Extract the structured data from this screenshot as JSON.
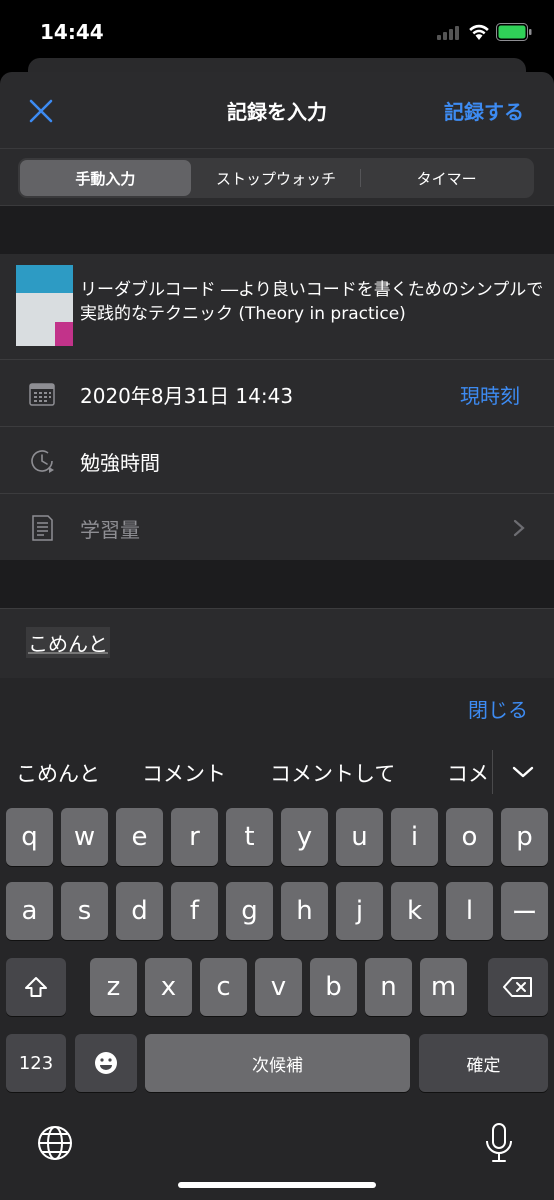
{
  "status": {
    "time": "14:44"
  },
  "nav": {
    "title": "記録を入力",
    "save_label": "記録する"
  },
  "tabs": [
    "手動入力",
    "ストップウォッチ",
    "タイマー"
  ],
  "book": {
    "title": "リーダブルコード ―より良いコードを書くためのシンプルで実践的なテクニック (Theory in practice)"
  },
  "fields": {
    "date": "2020年8月31日 14:43",
    "now_label": "現時刻",
    "study_time": "勉強時間",
    "amount_placeholder": "学習量"
  },
  "comment": {
    "value": "こめんと"
  },
  "keyboard": {
    "close_label": "閉じる",
    "suggestions": [
      "こめんと",
      "コメント",
      "コメントして",
      "コメ"
    ],
    "row1": [
      "q",
      "w",
      "e",
      "r",
      "t",
      "y",
      "u",
      "i",
      "o",
      "p"
    ],
    "row2": [
      "a",
      "s",
      "d",
      "f",
      "g",
      "h",
      "j",
      "k",
      "l",
      "ー"
    ],
    "row3": [
      "z",
      "x",
      "c",
      "v",
      "b",
      "n",
      "m"
    ],
    "num_label": "123",
    "space_label": "次候補",
    "confirm_label": "確定"
  },
  "colors": {
    "accent": "#3d8bf2",
    "background": "#1c1c1e",
    "cell": "#2b2b2d"
  }
}
